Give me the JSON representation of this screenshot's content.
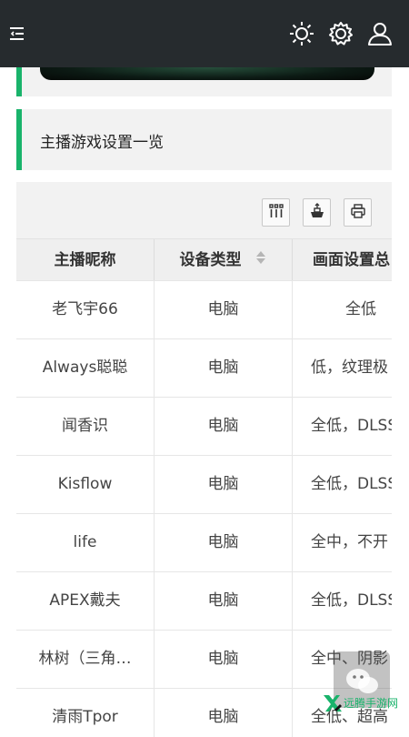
{
  "header": {
    "menu_icon": "menu-icon",
    "icons": [
      "brightness-icon",
      "gear-icon",
      "user-icon"
    ]
  },
  "section": {
    "title": "主播游戏设置一览"
  },
  "toolbar": {
    "buttons": [
      "columns-icon",
      "export-icon",
      "print-icon"
    ]
  },
  "table": {
    "columns": [
      "主播昵称",
      "设备类型",
      "画面设置总"
    ],
    "rows": [
      [
        "老飞宇66",
        "电脑",
        "全低"
      ],
      [
        "Always聪聪",
        "电脑",
        "低，纹理极"
      ],
      [
        "闻香识",
        "电脑",
        "全低，DLSS"
      ],
      [
        "Kisflow",
        "电脑",
        "全低，DLSS"
      ],
      [
        "life",
        "电脑",
        "全中，不开"
      ],
      [
        "APEX戴夫",
        "电脑",
        "全低，DLSS"
      ],
      [
        "林树（三角…",
        "电脑",
        "全中、阴影"
      ],
      [
        "清雨Tpor",
        "电脑",
        "全低、超高"
      ]
    ]
  },
  "watermark": {
    "text": "远腾手游网"
  },
  "colors": {
    "accent": "#19b36b",
    "header_bg": "#262b2e"
  }
}
